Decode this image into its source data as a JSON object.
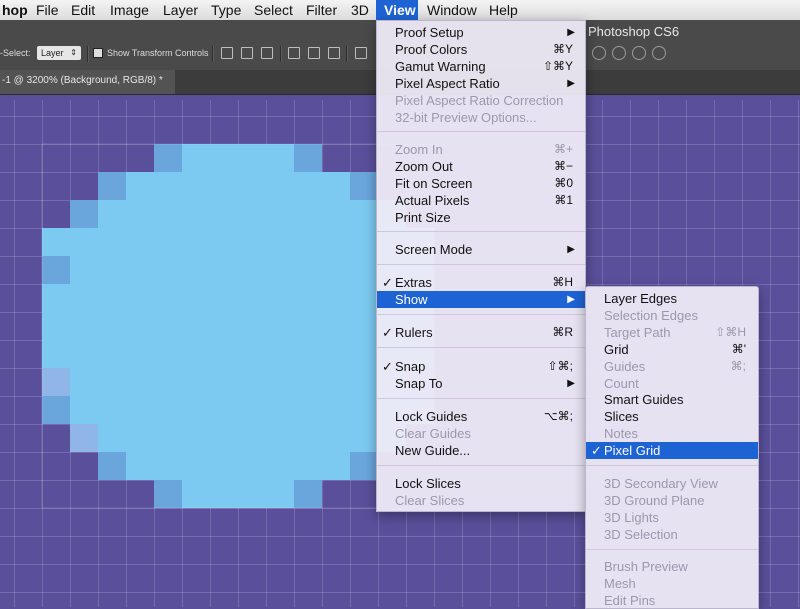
{
  "menubar": {
    "items": [
      {
        "label": "hop"
      },
      {
        "label": "File"
      },
      {
        "label": "Edit"
      },
      {
        "label": "Image"
      },
      {
        "label": "Layer"
      },
      {
        "label": "Type"
      },
      {
        "label": "Select"
      },
      {
        "label": "Filter"
      },
      {
        "label": "3D"
      },
      {
        "label": "View"
      },
      {
        "label": "Window"
      },
      {
        "label": "Help"
      }
    ]
  },
  "app": {
    "title": "Photoshop CS6"
  },
  "options": {
    "auto_select_label": "-Select:",
    "layer_select": "Layer",
    "show_transform_label": "Show Transform Controls"
  },
  "document": {
    "tab_title": "-1 @ 3200% (Background, RGB/8) *"
  },
  "colors": {
    "accent": "#1d63d3",
    "canvas": "#5a4f9b",
    "fill": "#7ccaf1"
  },
  "view_menu": {
    "items": [
      {
        "label": "Proof Setup",
        "shortcut": "▶"
      },
      {
        "label": "Proof Colors",
        "shortcut": "⌘Y"
      },
      {
        "label": "Gamut Warning",
        "shortcut": "⇧⌘Y"
      },
      {
        "label": "Pixel Aspect Ratio",
        "shortcut": "▶"
      },
      {
        "label": "Pixel Aspect Ratio Correction",
        "shortcut": ""
      },
      {
        "label": "32-bit Preview Options...",
        "shortcut": ""
      },
      {
        "label": "Zoom In",
        "shortcut": "⌘+"
      },
      {
        "label": "Zoom Out",
        "shortcut": "⌘−"
      },
      {
        "label": "Fit on Screen",
        "shortcut": "⌘0"
      },
      {
        "label": "Actual Pixels",
        "shortcut": "⌘1"
      },
      {
        "label": "Print Size",
        "shortcut": ""
      },
      {
        "label": "Screen Mode",
        "shortcut": "▶"
      },
      {
        "label": "Extras",
        "shortcut": "⌘H"
      },
      {
        "label": "Show",
        "shortcut": "▶"
      },
      {
        "label": "Rulers",
        "shortcut": "⌘R"
      },
      {
        "label": "Snap",
        "shortcut": "⇧⌘;"
      },
      {
        "label": "Snap To",
        "shortcut": "▶"
      },
      {
        "label": "Lock Guides",
        "shortcut": "⌥⌘;"
      },
      {
        "label": "Clear Guides",
        "shortcut": ""
      },
      {
        "label": "New Guide...",
        "shortcut": ""
      },
      {
        "label": "Lock Slices",
        "shortcut": ""
      },
      {
        "label": "Clear Slices",
        "shortcut": ""
      }
    ]
  },
  "show_menu": {
    "items": [
      {
        "label": "Layer Edges",
        "shortcut": ""
      },
      {
        "label": "Selection Edges",
        "shortcut": ""
      },
      {
        "label": "Target Path",
        "shortcut": "⇧⌘H"
      },
      {
        "label": "Grid",
        "shortcut": "⌘'"
      },
      {
        "label": "Guides",
        "shortcut": "⌘;"
      },
      {
        "label": "Count",
        "shortcut": ""
      },
      {
        "label": "Smart Guides",
        "shortcut": ""
      },
      {
        "label": "Slices",
        "shortcut": ""
      },
      {
        "label": "Notes",
        "shortcut": ""
      },
      {
        "label": "Pixel Grid",
        "shortcut": ""
      },
      {
        "label": "3D Secondary View",
        "shortcut": ""
      },
      {
        "label": "3D Ground Plane",
        "shortcut": ""
      },
      {
        "label": "3D Lights",
        "shortcut": ""
      },
      {
        "label": "3D Selection",
        "shortcut": ""
      },
      {
        "label": "Brush Preview",
        "shortcut": ""
      },
      {
        "label": "Mesh",
        "shortcut": ""
      },
      {
        "label": "Edit Pins",
        "shortcut": ""
      }
    ]
  },
  "check_glyph": "✓"
}
